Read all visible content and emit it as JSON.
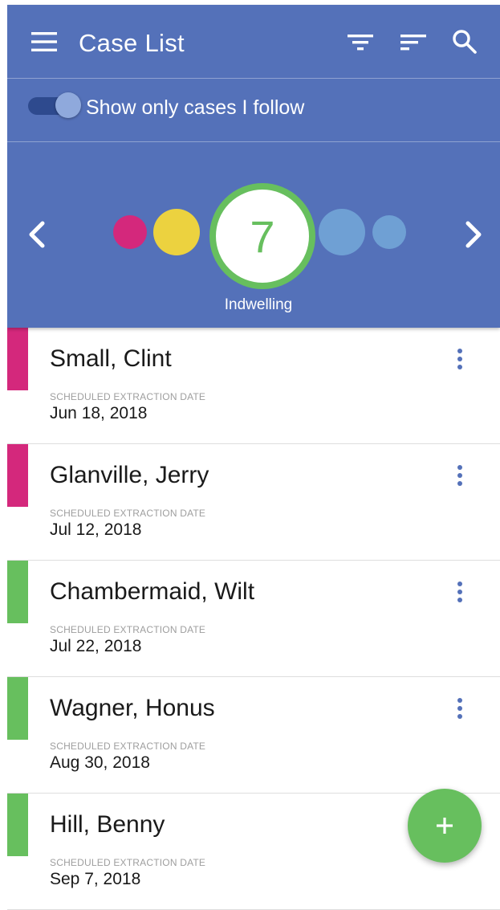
{
  "toolbar": {
    "title": "Case List",
    "menu_icon": "menu-icon",
    "filter_icon": "filter-icon",
    "sort_icon": "sort-icon",
    "search_icon": "search-icon"
  },
  "follow_toggle": {
    "label": "Show only cases I follow",
    "on": true
  },
  "stage_carousel": {
    "dots": [
      {
        "color": "#d4287c"
      },
      {
        "color": "#ecd23f"
      },
      {
        "color": "#6fa0d4"
      },
      {
        "color": "#6fa0d4"
      }
    ],
    "selected": {
      "count": "7",
      "label": "Indwelling",
      "color": "#67bf5e"
    },
    "prev_icon": "chevron-left-icon",
    "next_icon": "chevron-right-icon"
  },
  "cases": [
    {
      "name": "Small, Clint",
      "date_caption": "SCHEDULED EXTRACTION DATE",
      "date": "Jun 18, 2018",
      "status_color": "#d4287c"
    },
    {
      "name": "Glanville, Jerry",
      "date_caption": "SCHEDULED EXTRACTION DATE",
      "date": "Jul 12, 2018",
      "status_color": "#d4287c"
    },
    {
      "name": "Chambermaid, Wilt",
      "date_caption": "SCHEDULED EXTRACTION DATE",
      "date": "Jul 22, 2018",
      "status_color": "#67bf5e"
    },
    {
      "name": "Wagner, Honus",
      "date_caption": "SCHEDULED EXTRACTION DATE",
      "date": "Aug 30, 2018",
      "status_color": "#67bf5e"
    },
    {
      "name": "Hill, Benny",
      "date_caption": "SCHEDULED EXTRACTION DATE",
      "date": "Sep 7, 2018",
      "status_color": "#67bf5e"
    }
  ],
  "fab": {
    "icon": "plus-icon"
  },
  "colors": {
    "header": "#5471b9",
    "accent_green": "#67bf5e"
  }
}
